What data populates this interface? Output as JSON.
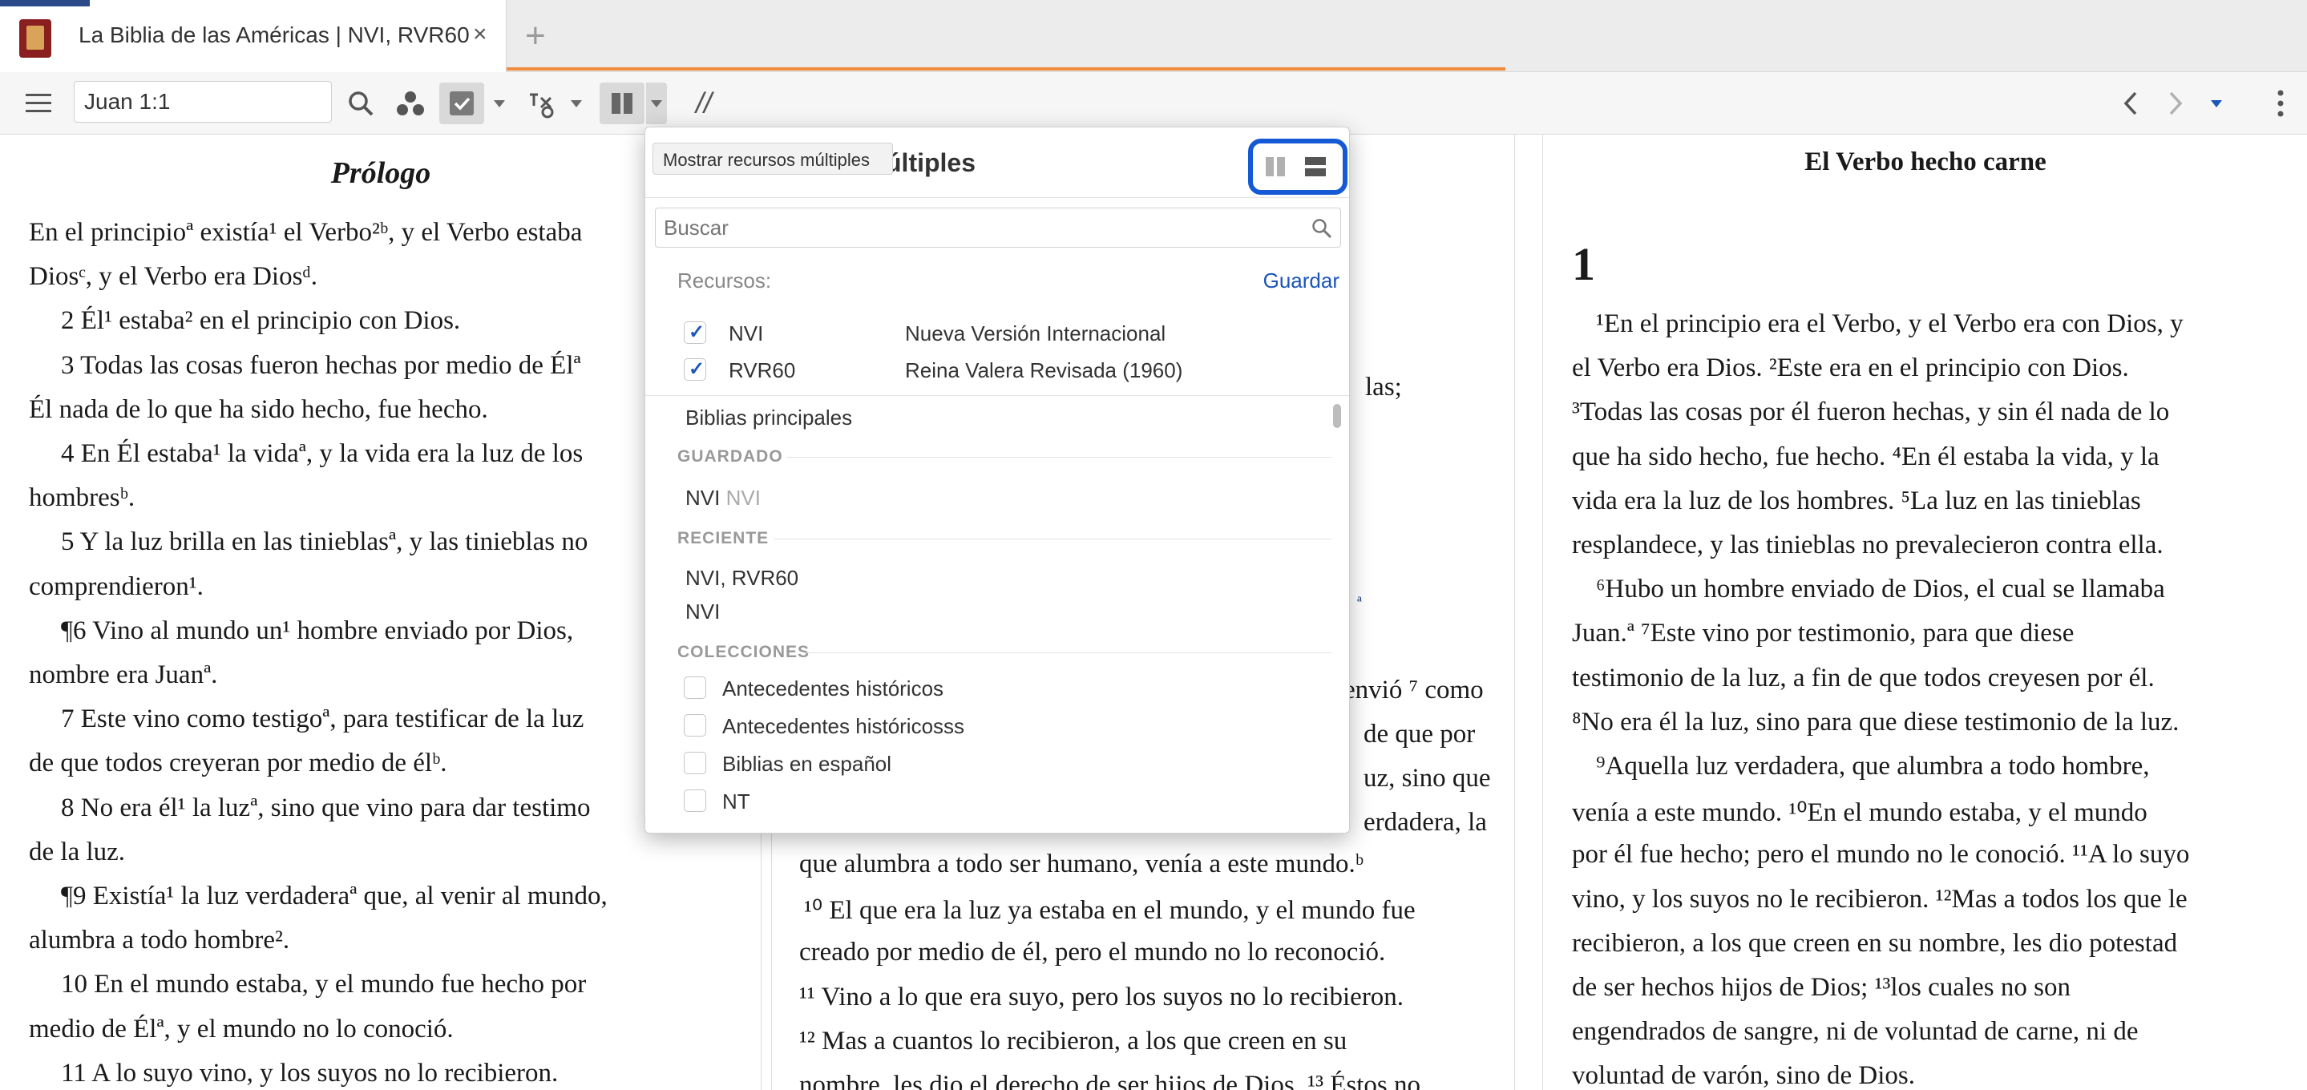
{
  "tab": {
    "title": "La Biblia de las Américas | NVI, RVR60",
    "close": "×",
    "add": "+"
  },
  "toolbar": {
    "reference": "Juan 1:1",
    "parallel_symbol": "//"
  },
  "left_pane": {
    "heading": "Prólogo",
    "lines": [
      "En el principioª existía¹ el Verbo²ᵇ, y el Verbo estaba",
      "Diosᶜ, y el Verbo era Diosᵈ.",
      "2 Él¹ estaba² en el principio con Dios.",
      "3 Todas las cosas fueron hechas por medio de Élª",
      "Él nada de lo que ha sido hecho, fue hecho.",
      "4 En Él estaba¹ la vidaª, y la vida era la luz de los",
      "hombresᵇ.",
      "5 Y la luz brilla en las tinieblasª, y las tinieblas no",
      "comprendieron¹.",
      "¶6 Vino al mundo un¹ hombre enviado por Dios,",
      "nombre era Juanª.",
      "7 Este vino como testigoª, para testificar de la luz",
      "de que todos creyeran por medio de élᵇ.",
      "8 No era él¹ la luzª, sino que vino para dar testimo",
      "de la luz.",
      "¶9 Existía¹ la luz verdaderaª que, al venir al mundo,",
      "alumbra a todo hombre².",
      "10 En el mundo estaba, y el mundo fue hecho por",
      "medio de Élª, y el mundo no lo conoció.",
      "11 A lo suyo vino, y los suyos no lo recibieron."
    ]
  },
  "mid_pane": {
    "fragments": [
      "las;",
      "ª",
      "envió ⁷ como",
      "de que por",
      "uz, sino que",
      "erdadera, la"
    ],
    "lines": [
      "que alumbra a todo ser humano, venía a este mundo.ᵇ",
      "¹⁰ El que era la luz ya estaba en el mundo, y el mundo fue",
      "creado por medio de él, pero el mundo no lo reconoció.",
      "¹¹ Vino a lo que era suyo, pero los suyos no lo recibieron.",
      "¹² Mas a cuantos lo recibieron, a los que creen en su",
      "nombre, les dio el derecho de ser hijos de Dios. ¹³ Éstos no"
    ]
  },
  "right_pane": {
    "heading": "El Verbo hecho carne",
    "chapter": "1",
    "lines": [
      "¹En el principio era el Verbo, y el Verbo era con Dios, y",
      "el Verbo era Dios. ²Este era en el principio con Dios.",
      "³Todas las cosas por él fueron hechas, y sin él nada de lo",
      "que ha sido hecho, fue hecho. ⁴En él estaba la vida, y la",
      "vida era la luz de los hombres. ⁵La luz en las tinieblas",
      "resplandece, y las tinieblas no prevalecieron contra ella.",
      "⁶Hubo un hombre enviado de Dios, el cual se llamaba",
      "Juan.ª ⁷Este vino por testimonio, para que diese",
      "testimonio de la luz, a fin de que todos creyesen por él.",
      "⁸No era él la luz, sino para que diese testimonio de la luz.",
      "⁹Aquella luz verdadera, que alumbra a todo hombre,",
      "venía a este mundo. ¹⁰En el mundo estaba, y el mundo",
      "por él fue hecho; pero el mundo no le conoció. ¹¹A lo suyo",
      "vino, y los suyos no le recibieron. ¹²Mas a todos los que le",
      "recibieron, a los que creen en su nombre, les dio potestad",
      "de ser hechos hijos de Dios; ¹³los cuales no son",
      "engendrados de sangre, ni de voluntad de carne, ni de",
      "voluntad de varón, sino de Dios."
    ]
  },
  "popup": {
    "title": "últiples",
    "tooltip": "Mostrar recursos múltiples",
    "search_placeholder": "Buscar",
    "resources_label": "Recursos:",
    "save_label": "Guardar",
    "resources": [
      {
        "abbr": "NVI",
        "name": "Nueva Versión Internacional",
        "checked": true
      },
      {
        "abbr": "RVR60",
        "name": "Reina Valera Revisada (1960)",
        "checked": true
      }
    ],
    "group_label": "Biblias principales",
    "saved_heading": "GUARDADO",
    "saved_items": [
      {
        "name": "NVI",
        "sub": "NVI"
      }
    ],
    "recent_heading": "RECIENTE",
    "recent_items": [
      "NVI, RVR60",
      "NVI"
    ],
    "collections_heading": "COLECCIONES",
    "collections": [
      "Antecedentes históricos",
      "Antecedentes históricosss",
      "Biblias en español",
      "NT"
    ]
  }
}
